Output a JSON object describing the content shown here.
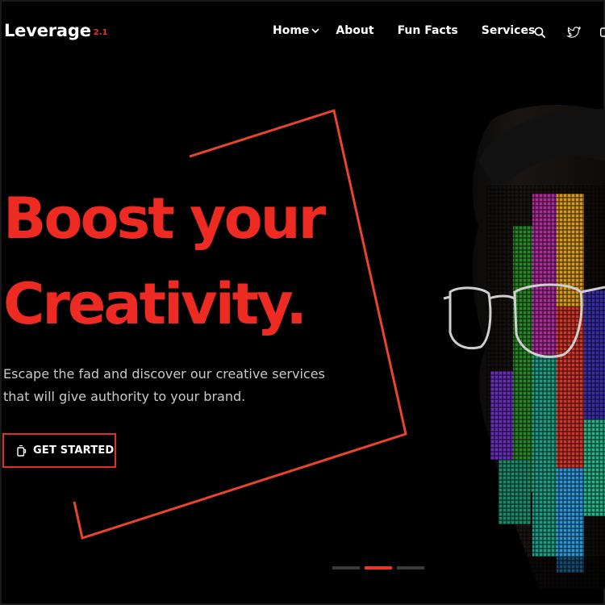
{
  "brand": {
    "name": "Leverage",
    "version": "2.1",
    "accent": "#e8362a"
  },
  "nav": {
    "items": [
      {
        "label": "Home",
        "has_dropdown": true
      },
      {
        "label": "About"
      },
      {
        "label": "Fun Facts"
      },
      {
        "label": "Services"
      }
    ],
    "icons": [
      "search-icon",
      "twitter-icon",
      "overflow-icon"
    ]
  },
  "hero": {
    "headline_line1": "Boost your",
    "headline_line2": "Creativity.",
    "subtext_line1": "Escape the fad and discover our creative services",
    "subtext_line2": "that will give authority to your brand.",
    "cta_label": "GET STARTED",
    "cta_icon": "cup-icon"
  },
  "slider": {
    "count": 3,
    "active_index": 1
  }
}
